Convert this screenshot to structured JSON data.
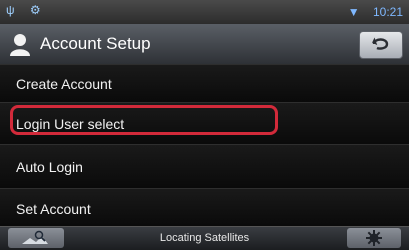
{
  "statusbar": {
    "left_icons": "ψ ⚙",
    "time": "10:21"
  },
  "header": {
    "title": "Account Setup"
  },
  "menu": {
    "items": [
      {
        "label": "Create Account"
      },
      {
        "label": "Login User select"
      },
      {
        "label": "Auto Login"
      },
      {
        "label": "Set Account"
      }
    ]
  },
  "footer": {
    "status": "Locating Satellites"
  },
  "colors": {
    "highlight_ring": "#d22a3a",
    "status_icons": "#7fb8ff"
  }
}
